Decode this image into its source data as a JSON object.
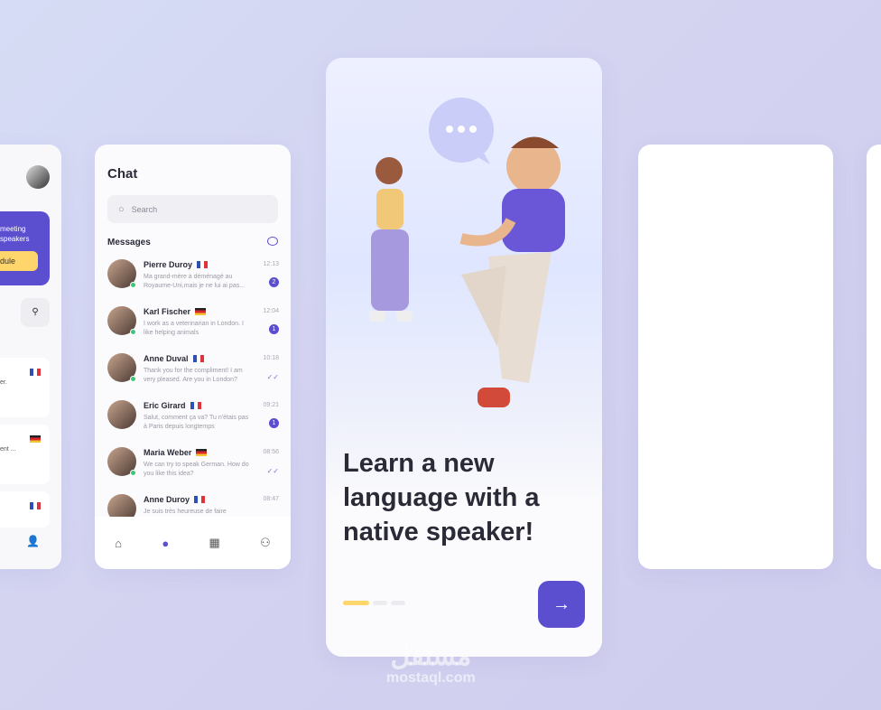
{
  "left_card": {
    "banner_line1": "meeting",
    "banner_line2": "speakers",
    "schedule_button": "dule",
    "items": [
      {
        "flag": "fr",
        "snippet": "er."
      },
      {
        "flag": "de",
        "snippet": "ent ..."
      },
      {
        "flag": "fr",
        "snippet": ""
      }
    ]
  },
  "chat": {
    "title": "Chat",
    "search_placeholder": "Search",
    "messages_label": "Messages",
    "items": [
      {
        "name": "Pierre Duroy",
        "flag": "fr",
        "message": "Ma grand-mère a déménagé au Royaume-Uni,mais je ne lui ai pas...",
        "time": "12:13",
        "unread": "2",
        "online": true
      },
      {
        "name": "Karl Fischer",
        "flag": "de",
        "message": "I work as a veterinarian in London. I like helping animals",
        "time": "12:04",
        "unread": "1",
        "online": true
      },
      {
        "name": "Anne Duval",
        "flag": "fr",
        "message": "Thank you for the compliment! I am very pleased. Are you in London?",
        "time": "10:18",
        "unread": null,
        "online": true
      },
      {
        "name": "Eric Girard",
        "flag": "fr",
        "message": "Salut, comment ça va? Tu n'étais pas à Paris depuis longtemps",
        "time": "09:21",
        "unread": "1",
        "online": false
      },
      {
        "name": "Maria Weber",
        "flag": "de",
        "message": "We can try to speak German. How do you like this idea?",
        "time": "08:56",
        "unread": null,
        "online": true
      },
      {
        "name": "Anne Duroy",
        "flag": "fr",
        "message": "Je suis très heureuse de faire",
        "time": "08:47",
        "unread": null,
        "online": false
      }
    ],
    "nav": [
      "home-icon",
      "chat-icon",
      "calendar-icon",
      "profile-icon"
    ]
  },
  "onboarding": {
    "headline": "Learn a new language with a native speaker!",
    "page": 1,
    "pages": 3,
    "next_icon": "arrow-right-icon"
  },
  "colors": {
    "accent": "#5b4fd0",
    "yellow": "#ffd66b",
    "online": "#3fc47a"
  },
  "watermark": {
    "arabic": "مستقل",
    "latin": "mostaql.com"
  }
}
